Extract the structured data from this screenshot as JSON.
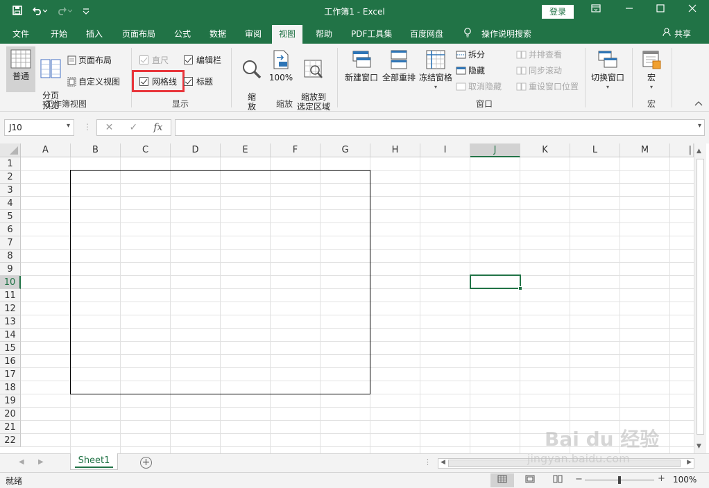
{
  "titlebar": {
    "title": "工作簿1  -  Excel",
    "login": "登录",
    "save_icon": "save-icon",
    "undo_icon": "undo-icon",
    "redo_icon": "redo-icon"
  },
  "tabs": [
    "文件",
    "开始",
    "插入",
    "页面布局",
    "公式",
    "数据",
    "审阅",
    "视图",
    "帮助",
    "PDF工具集",
    "百度网盘",
    "操作说明搜索"
  ],
  "share": "共享",
  "ribbon": {
    "workbook_views": {
      "label": "工作簿视图",
      "normal": "普通",
      "page_break": "分页\n预览",
      "page_layout": "页面布局",
      "custom_view": "自定义视图"
    },
    "show": {
      "label": "显示",
      "ruler": "直尺",
      "formula_bar": "编辑栏",
      "gridlines": "网格线",
      "headings": "标题"
    },
    "zoom": {
      "label": "缩放",
      "zoom": "缩\n放",
      "zoom100": "100%",
      "zoom_selection": "缩放到\n选定区域"
    },
    "window": {
      "label": "窗口",
      "new_window": "新建窗口",
      "arrange_all": "全部重排",
      "freeze_panes": "冻结窗格",
      "split": "拆分",
      "hide": "隐藏",
      "unhide": "取消隐藏",
      "side_by_side": "并排查看",
      "sync_scroll": "同步滚动",
      "reset_position": "重设窗口位置",
      "switch_windows": "切换窗口"
    },
    "macros": {
      "label": "宏",
      "macros": "宏"
    }
  },
  "formula_bar": {
    "name_box": "J10",
    "fx": "fx"
  },
  "columns": [
    "A",
    "B",
    "C",
    "D",
    "E",
    "F",
    "G",
    "H",
    "I",
    "J",
    "K",
    "L",
    "M",
    "N"
  ],
  "rows": [
    "1",
    "2",
    "3",
    "4",
    "5",
    "6",
    "7",
    "8",
    "9",
    "10",
    "11",
    "12",
    "13",
    "14",
    "15",
    "16",
    "17",
    "18",
    "19",
    "20",
    "21",
    "22"
  ],
  "sheet_tab": "Sheet1",
  "status": {
    "ready": "就绪",
    "zoom": "100%"
  },
  "watermark": {
    "brand": "Bai du 经验",
    "url": "jingyan.baidu.com"
  },
  "colors": {
    "excel_green": "#217346",
    "highlight_red": "#e8353b"
  }
}
